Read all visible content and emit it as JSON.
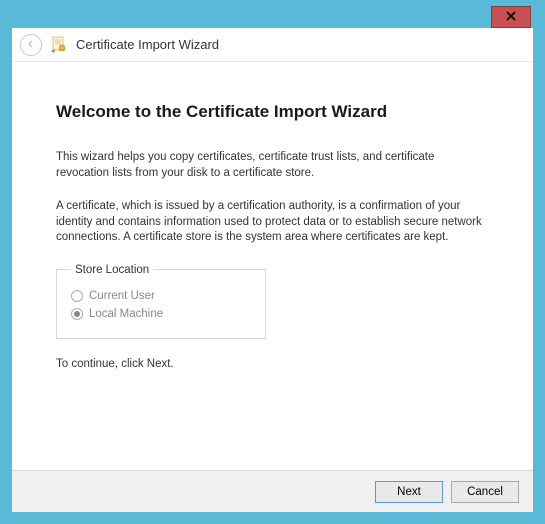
{
  "window": {
    "title": "Certificate Import Wizard"
  },
  "content": {
    "heading": "Welcome to the Certificate Import Wizard",
    "para1": "This wizard helps you copy certificates, certificate trust lists, and certificate revocation lists from your disk to a certificate store.",
    "para2": "A certificate, which is issued by a certification authority, is a confirmation of your identity and contains information used to protect data or to establish secure network connections. A certificate store is the system area where certificates are kept.",
    "storeLocation": {
      "legend": "Store Location",
      "options": [
        {
          "label": "Current User",
          "selected": false
        },
        {
          "label": "Local Machine",
          "selected": true
        }
      ]
    },
    "continueText": "To continue, click Next."
  },
  "footer": {
    "next": "Next",
    "cancel": "Cancel"
  }
}
